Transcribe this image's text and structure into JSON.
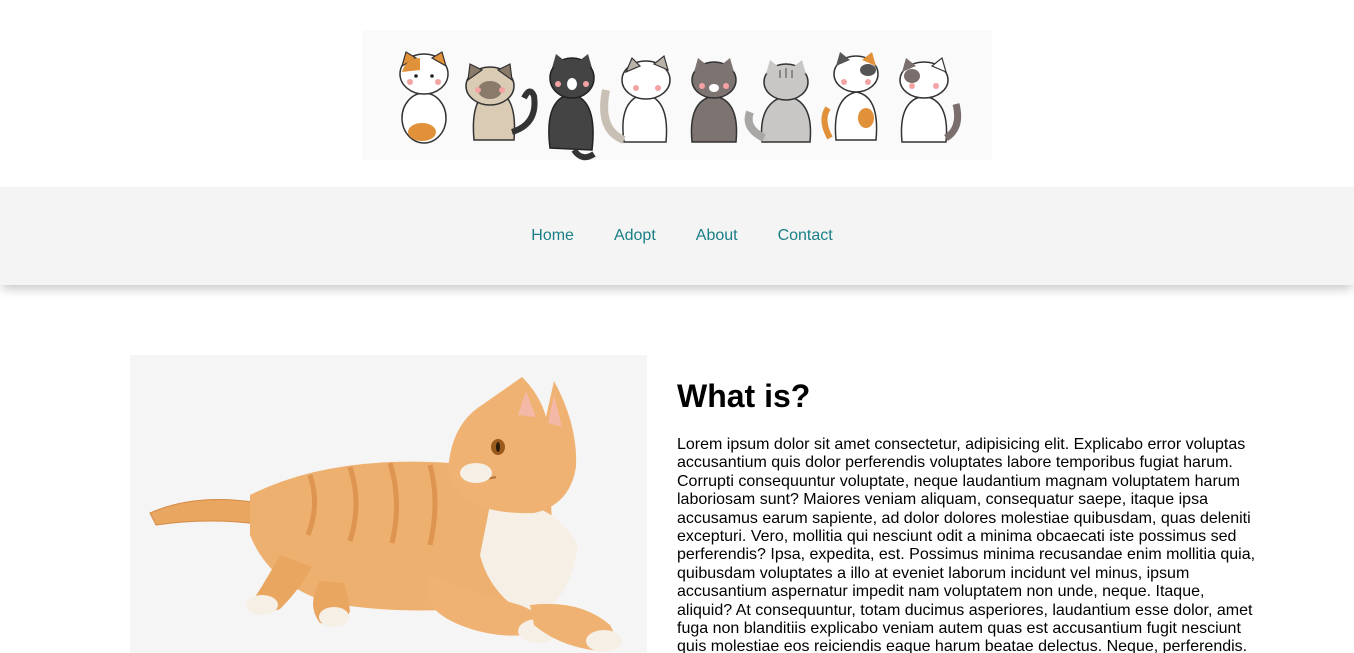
{
  "nav": {
    "items": [
      {
        "label": "Home"
      },
      {
        "label": "Adopt"
      },
      {
        "label": "About"
      },
      {
        "label": "Contact"
      }
    ],
    "link_color": "#1a7f86",
    "background": "#f4f4f4"
  },
  "banner": {
    "icon": "cartoon-cats-lineup",
    "cats": [
      "orange-white-cat",
      "siamese-cat",
      "black-cat",
      "grey-white-cat",
      "dark-grey-cat",
      "tabby-cat",
      "calico-cat",
      "white-spotted-cat"
    ]
  },
  "hero": {
    "image": "orange-tabby-cat-lying-down"
  },
  "article": {
    "heading": "What is?",
    "body": "Lorem ipsum dolor sit amet consectetur, adipisicing elit. Explicabo error voluptas accusantium quis dolor perferendis voluptates labore temporibus fugiat harum. Corrupti consequuntur voluptate, neque laudantium magnam voluptatem harum laboriosam sunt? Maiores veniam aliquam, consequatur saepe, itaque ipsa accusamus earum sapiente, ad dolor dolores molestiae quibusdam, quas deleniti excepturi. Vero, mollitia qui nesciunt odit a minima obcaecati iste possimus sed perferendis? Ipsa, expedita, est. Possimus minima recusandae enim mollitia quia, quibusdam voluptates a illo at eveniet laborum incidunt vel minus, ipsum accusantium aspernatur impedit nam voluptatem non unde, neque. Itaque, aliquid? At consequuntur, totam ducimus asperiores, laudantium esse dolor, amet fuga non blanditiis explicabo veniam autem quas est accusantium fugit nesciunt quis molestiae eos reiciendis eaque harum beatae delectus. Neque, perferendis."
  }
}
